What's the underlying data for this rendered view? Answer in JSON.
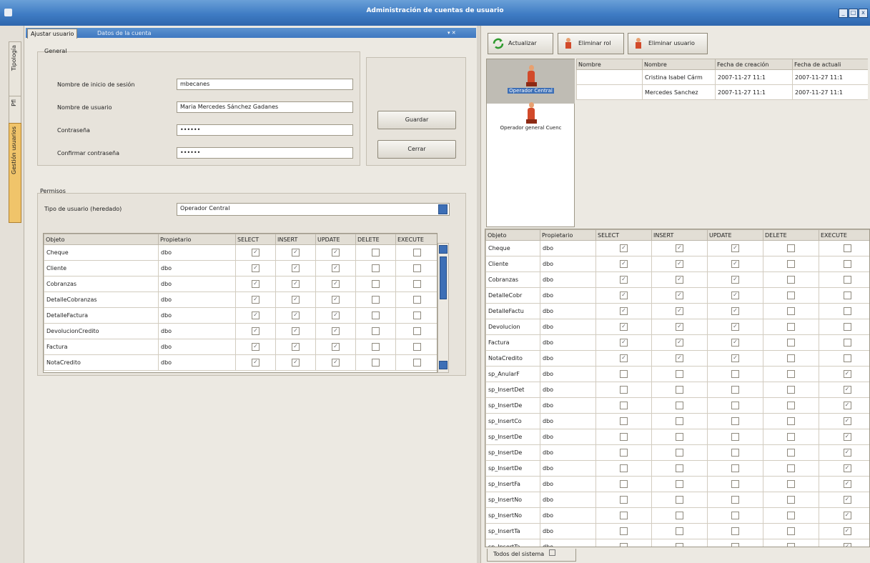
{
  "window": {
    "title": "Administración de cuentas de usuario",
    "controls": [
      "_",
      "□",
      "x"
    ]
  },
  "side_tabs": [
    "Tipología",
    "Pfl",
    "Gestión usuarios"
  ],
  "left": {
    "tabs": [
      "Ajustar usuario",
      "Datos de la cuenta"
    ],
    "general": {
      "legend": "General",
      "fields": [
        {
          "label": "Nombre de inicio de sesión",
          "value": "mbecanes"
        },
        {
          "label": "Nombre de usuario",
          "value": "Maria Mercedes Sánchez Gadanes"
        },
        {
          "label": "Contraseña",
          "value": "••••••"
        },
        {
          "label": "Confirmar contraseña",
          "value": "••••••"
        }
      ],
      "buttons": {
        "save": "Guardar",
        "close": "Cerrar"
      }
    },
    "permisos": {
      "legend": "Permisos",
      "tipo_label": "Tipo de usuario (heredado)",
      "tipo_value": "Operador Central",
      "columns": [
        "Objeto",
        "Propietario",
        "SELECT",
        "INSERT",
        "UPDATE",
        "DELETE",
        "EXECUTE"
      ],
      "rows": [
        {
          "obj": "Cheque",
          "owner": "dbo",
          "perms": [
            true,
            true,
            true,
            false,
            false
          ]
        },
        {
          "obj": "Cliente",
          "owner": "dbo",
          "perms": [
            true,
            true,
            true,
            false,
            false
          ]
        },
        {
          "obj": "Cobranzas",
          "owner": "dbo",
          "perms": [
            true,
            true,
            true,
            false,
            false
          ]
        },
        {
          "obj": "DetalleCobranzas",
          "owner": "dbo",
          "perms": [
            true,
            true,
            true,
            false,
            false
          ]
        },
        {
          "obj": "DetalleFactura",
          "owner": "dbo",
          "perms": [
            true,
            true,
            true,
            false,
            false
          ]
        },
        {
          "obj": "DevolucionCredito",
          "owner": "dbo",
          "perms": [
            true,
            true,
            true,
            false,
            false
          ]
        },
        {
          "obj": "Factura",
          "owner": "dbo",
          "perms": [
            true,
            true,
            true,
            false,
            false
          ]
        },
        {
          "obj": "NotaCredito",
          "owner": "dbo",
          "perms": [
            true,
            true,
            true,
            false,
            false
          ]
        }
      ]
    }
  },
  "right": {
    "toolbar": [
      {
        "label": "Actualizar",
        "icon": "refresh-icon"
      },
      {
        "label": "Eliminar rol",
        "icon": "user-delete-icon"
      },
      {
        "label": "Eliminar usuario",
        "icon": "user-remove-icon"
      }
    ],
    "users": [
      {
        "label": "Operador Central"
      },
      {
        "label": "Operador general Cuenc"
      }
    ],
    "users_table": {
      "columns": [
        "Nombre",
        "Nombre",
        "Fecha de creación",
        "Fecha de actuali"
      ],
      "rows": [
        [
          "",
          "Cristina Isabel Cárm",
          "2007-11-27 11:1",
          "2007-11-27 11:1"
        ],
        [
          "",
          "Mercedes Sanchez",
          "2007-11-27 11:1",
          "2007-11-27 11:1"
        ]
      ]
    },
    "perm_table": {
      "columns": [
        "Objeto",
        "Propietario",
        "SELECT",
        "INSERT",
        "UPDATE",
        "DELETE",
        "EXECUTE"
      ],
      "rows": [
        {
          "obj": "Cheque",
          "owner": "dbo",
          "perms": [
            true,
            true,
            true,
            false,
            false
          ]
        },
        {
          "obj": "Cliente",
          "owner": "dbo",
          "perms": [
            true,
            true,
            true,
            false,
            false
          ]
        },
        {
          "obj": "Cobranzas",
          "owner": "dbo",
          "perms": [
            true,
            true,
            true,
            false,
            false
          ]
        },
        {
          "obj": "DetalleCobr",
          "owner": "dbo",
          "perms": [
            true,
            true,
            true,
            false,
            false
          ]
        },
        {
          "obj": "DetalleFactu",
          "owner": "dbo",
          "perms": [
            true,
            true,
            true,
            false,
            false
          ]
        },
        {
          "obj": "Devolucion",
          "owner": "dbo",
          "perms": [
            true,
            true,
            true,
            false,
            false
          ]
        },
        {
          "obj": "Factura",
          "owner": "dbo",
          "perms": [
            true,
            true,
            true,
            false,
            false
          ]
        },
        {
          "obj": "NotaCredito",
          "owner": "dbo",
          "perms": [
            true,
            true,
            true,
            false,
            false
          ]
        },
        {
          "obj": "sp_AnularF",
          "owner": "dbo",
          "perms": [
            false,
            false,
            false,
            false,
            true
          ]
        },
        {
          "obj": "sp_InsertDet",
          "owner": "dbo",
          "perms": [
            false,
            false,
            false,
            false,
            true
          ]
        },
        {
          "obj": "sp_InsertDe",
          "owner": "dbo",
          "perms": [
            false,
            false,
            false,
            false,
            true
          ]
        },
        {
          "obj": "sp_InsertCo",
          "owner": "dbo",
          "perms": [
            false,
            false,
            false,
            false,
            true
          ]
        },
        {
          "obj": "sp_InsertDe",
          "owner": "dbo",
          "perms": [
            false,
            false,
            false,
            false,
            true
          ]
        },
        {
          "obj": "sp_InsertDe",
          "owner": "dbo",
          "perms": [
            false,
            false,
            false,
            false,
            true
          ]
        },
        {
          "obj": "sp_InsertDe",
          "owner": "dbo",
          "perms": [
            false,
            false,
            false,
            false,
            true
          ]
        },
        {
          "obj": "sp_InsertFa",
          "owner": "dbo",
          "perms": [
            false,
            false,
            false,
            false,
            true
          ]
        },
        {
          "obj": "sp_InsertNo",
          "owner": "dbo",
          "perms": [
            false,
            false,
            false,
            false,
            true
          ]
        },
        {
          "obj": "sp_InsertNo",
          "owner": "dbo",
          "perms": [
            false,
            false,
            false,
            false,
            true
          ]
        },
        {
          "obj": "sp_InsertTa",
          "owner": "dbo",
          "perms": [
            false,
            false,
            false,
            false,
            true
          ]
        },
        {
          "obj": "sp_InsertTa",
          "owner": "dbo",
          "perms": [
            false,
            false,
            false,
            false,
            true
          ]
        }
      ]
    },
    "bottom_tab": "Todos del sistema"
  }
}
